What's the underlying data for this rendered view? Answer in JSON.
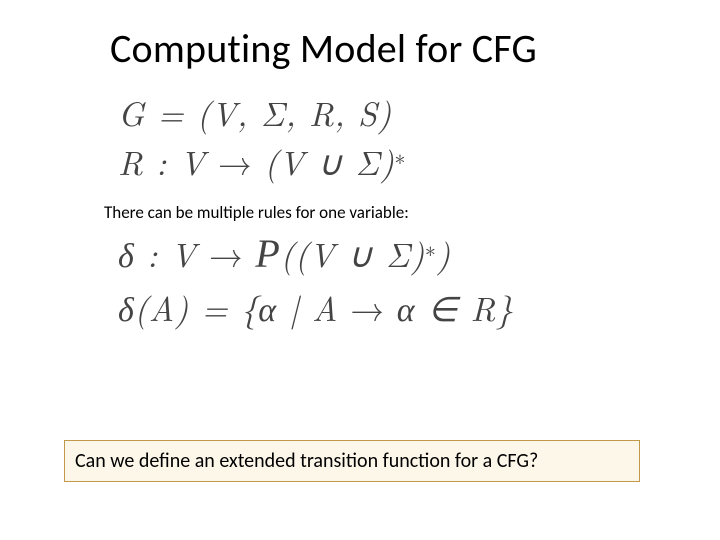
{
  "title": "Computing Model for CFG",
  "eq1_line1": "G = (V, Σ, R, S)",
  "eq1_line2_lhs": "R : V",
  "eq1_line2_rhs": "(V ∪ Σ)",
  "eq1_line2_star": "∗",
  "note": "There can be multiple rules for one variable:",
  "eq2_line1_lhs": "δ : V",
  "eq2_line1_P": "P",
  "eq2_line1_open": "((V ∪ Σ)",
  "eq2_line1_star": "∗",
  "eq2_line1_close": ")",
  "eq2_line2_lhs": "δ(A) = {α | A",
  "eq2_line2_rhs": "α ∈ R}",
  "arrow": "→",
  "callout": "Can we define an extended transition function for a CFG?"
}
